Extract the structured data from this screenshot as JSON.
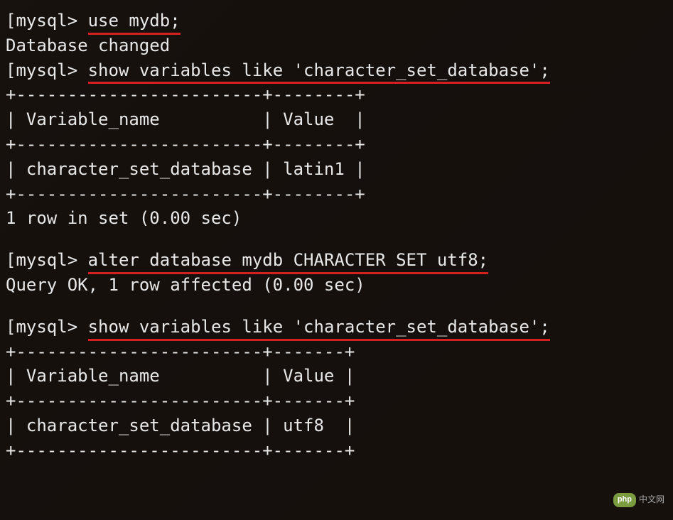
{
  "terminal": {
    "prompt_open": "[",
    "prompt": "mysql> ",
    "cmd1": "use mydb;",
    "resp1": "Database changed",
    "cmd2": "show variables like 'character_set_database';",
    "table1": {
      "border_top": "+------------------------+--------+",
      "header": "| Variable_name          | Value  |",
      "border_mid": "+------------------------+--------+",
      "row": "| character_set_database | latin1 |",
      "border_bot": "+------------------------+--------+"
    },
    "resp2": "1 row in set (0.00 sec)",
    "cmd3": "alter database mydb CHARACTER SET utf8;",
    "resp3": "Query OK, 1 row affected (0.00 sec)",
    "cmd4": "show variables like 'character_set_database';",
    "table2": {
      "border_top": "+------------------------+-------+",
      "header": "| Variable_name          | Value |",
      "border_mid": "+------------------------+-------+",
      "row": "| character_set_database | utf8  |",
      "border_bot": "+------------------------+-------+"
    }
  },
  "watermark": {
    "badge": "php",
    "text": "中文网"
  }
}
